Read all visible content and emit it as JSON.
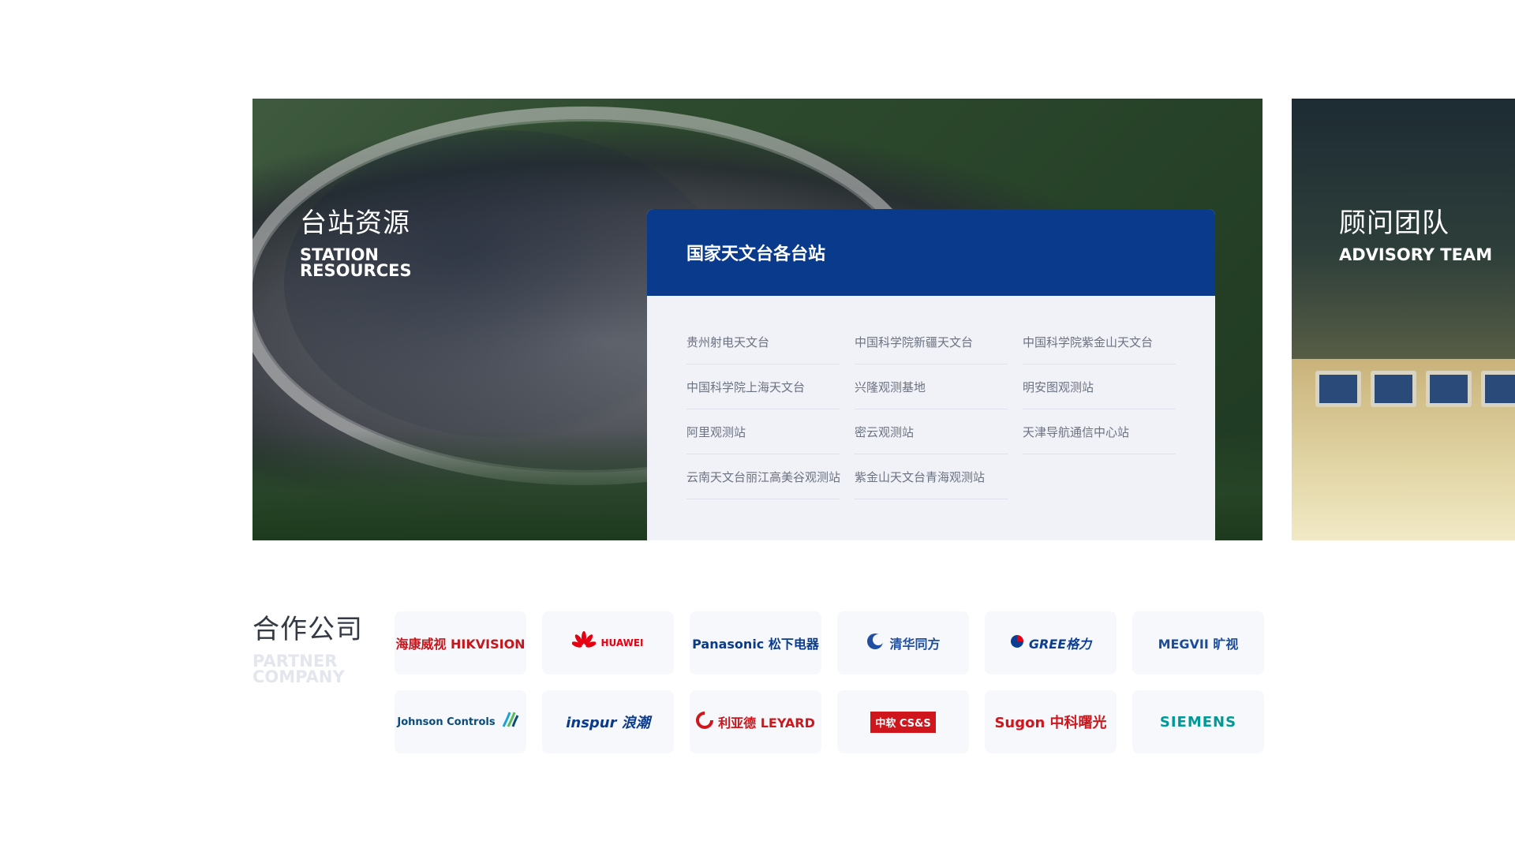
{
  "station": {
    "title_cn": "台站资源",
    "title_en": "STATION RESOURCES",
    "card_title": "国家天文台各台站",
    "items": [
      "贵州射电天文台",
      "中国科学院新疆天文台",
      "中国科学院紫金山天文台",
      "中国科学院上海天文台",
      "兴隆观测基地",
      "明安图观测站",
      "阿里观测站",
      "密云观测站",
      "天津导航通信中心站",
      "云南天文台丽江高美谷观测站",
      "紫金山天文台青海观测站"
    ]
  },
  "advisory": {
    "title_cn": "顾问团队",
    "title_en": "ADVISORY TEAM"
  },
  "partners": {
    "title_cn": "合作公司",
    "title_en": "PARTNER COMPANY",
    "logos": [
      {
        "text": "海康威视 HIKVISION",
        "color": "#c4161c",
        "icon": "hikvision-logo"
      },
      {
        "text": "HUAWEI",
        "color": "#e60012",
        "icon": "huawei-logo"
      },
      {
        "text": "Panasonic 松下电器",
        "color": "#0a3a8c",
        "icon": "panasonic-logo"
      },
      {
        "text": "清华同方",
        "color": "#1f4ea3",
        "icon": "tsinghua-tongfang-logo"
      },
      {
        "text": "GREE格力",
        "color": "#0b3e93",
        "icon": "gree-logo"
      },
      {
        "text": "MEGVII 旷视",
        "color": "#1a4c9b",
        "icon": "megvii-logo"
      },
      {
        "text": "Johnson Controls",
        "color": "#0b4b7a",
        "icon": "johnson-controls-logo"
      },
      {
        "text": "inspur 浪潮",
        "color": "#0a3a8c",
        "icon": "inspur-logo"
      },
      {
        "text": "利亚德 LEYARD",
        "color": "#d0161d",
        "icon": "leyard-logo"
      },
      {
        "text": "中软 CS&S",
        "color": "#d0161d",
        "icon": "css-logo"
      },
      {
        "text": "Sugon 中科曙光",
        "color": "#d0161d",
        "icon": "sugon-logo"
      },
      {
        "text": "SIEMENS",
        "color": "#009999",
        "icon": "siemens-logo"
      }
    ]
  },
  "colors": {
    "card_header": "#0a3a8c",
    "card_bg": "#f0f2f8"
  }
}
